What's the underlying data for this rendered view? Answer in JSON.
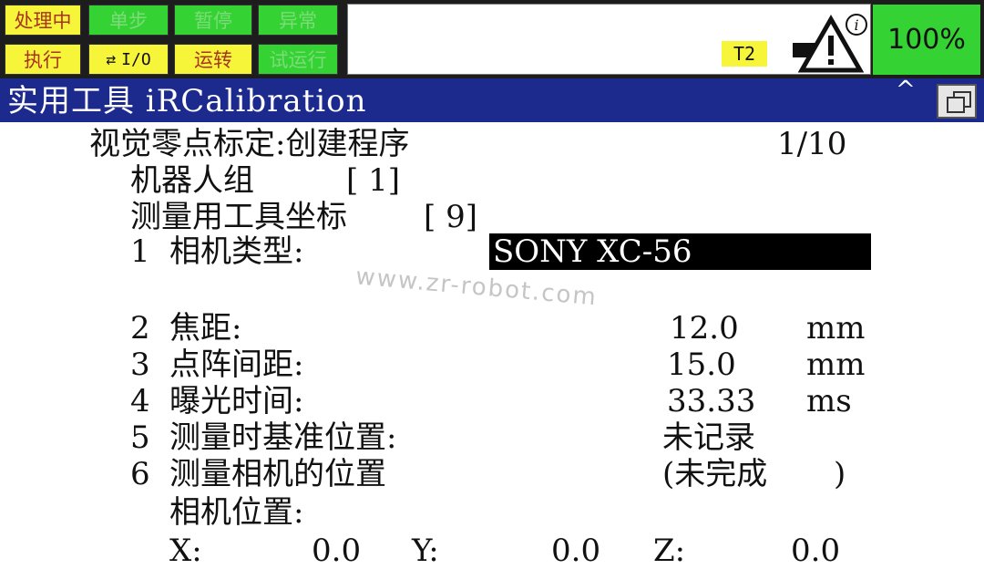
{
  "status": {
    "buttons": [
      {
        "label": "处理中",
        "style": "yellow"
      },
      {
        "label": "单步",
        "style": "green"
      },
      {
        "label": "暂停",
        "style": "green"
      },
      {
        "label": "异常",
        "style": "green"
      },
      {
        "label": "执行",
        "style": "yellow"
      },
      {
        "label": "I/O",
        "style": "yellowb"
      },
      {
        "label": "运转",
        "style": "yellow"
      },
      {
        "label": "试运行",
        "style": "green"
      }
    ],
    "mode": "T2",
    "override": "100%",
    "warning_icon": "warning-triangle-icon",
    "info_icon": "info-icon",
    "colors": {
      "yellow": "#f7f53a",
      "green": "#35d233",
      "title_bar": "#1c2a8e"
    }
  },
  "title": {
    "text": "实用工具 iRCalibration",
    "caret": "^"
  },
  "screen": {
    "header": "视觉零点标定:创建程序",
    "page": "1/10",
    "robot_group_label": "机器人组",
    "robot_group_value": "[ 1]",
    "tool_frame_label": "测量用工具坐标",
    "tool_frame_value": "[ 9]",
    "items": [
      {
        "num": "1",
        "label": "相机类型:",
        "value": "SONY XC-56",
        "unit": ""
      },
      {
        "num": "2",
        "label": "焦距:",
        "value": "12.0",
        "unit": "mm"
      },
      {
        "num": "3",
        "label": "点阵间距:",
        "value": "15.0",
        "unit": "mm"
      },
      {
        "num": "4",
        "label": "曝光时间:",
        "value": "33.33",
        "unit": "ms"
      },
      {
        "num": "5",
        "label": "测量时基准位置:",
        "value": "未记录",
        "unit": ""
      },
      {
        "num": "6",
        "label": "测量相机的位置",
        "value": "(未完成",
        "unit": ")"
      }
    ],
    "camera_position_label": "相机位置:",
    "x_label": "X:",
    "x_value": "0.0",
    "y_label": "Y:",
    "y_value": "0.0",
    "z_label": "Z:",
    "z_value": "0.0"
  },
  "watermark": "www.zr-robot.com"
}
